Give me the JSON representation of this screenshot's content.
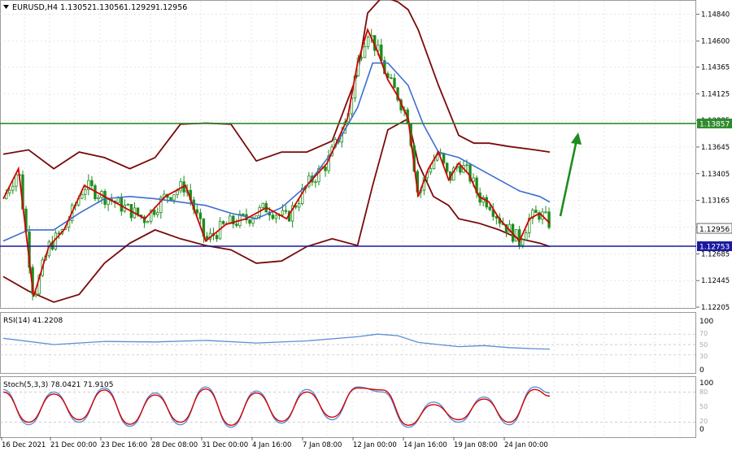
{
  "header": {
    "symbol_label": "EURUSD,H4",
    "ohlc": [
      "1.13052",
      "1.13056",
      "1.12929",
      "1.12956"
    ]
  },
  "colors": {
    "price_line": "#d40000",
    "ma_line": "#3b6fd1",
    "bands": "#7a0a0a",
    "candles": "#1e8c1e",
    "support": "#1a1aa0",
    "resistance": "#2e8b2e",
    "arrow": "#1e8c1e",
    "rsi_line": "#5b8fd6",
    "stoch_main": "#5b8fd6",
    "stoch_signal": "#d40000",
    "grid": "#d7d7d7"
  },
  "price_axis": {
    "ticks": [
      "1.14840",
      "1.14600",
      "1.14365",
      "1.14125",
      "1.13885",
      "1.13645",
      "1.13405",
      "1.13165",
      "1.12925",
      "1.12685",
      "1.12445",
      "1.12205"
    ],
    "current_price": "1.12956",
    "resistance_label": "1.13857",
    "support_label": "1.12753"
  },
  "time_axis": {
    "labels": [
      "16 Dec 2021",
      "21 Dec 00:00",
      "23 Dec 16:00",
      "28 Dec 08:00",
      "31 Dec 00:00",
      "4 Jan 16:00",
      "7 Jan 08:00",
      "12 Jan 00:00",
      "14 Jan 16:00",
      "19 Jan 08:00",
      "24 Jan 00:00"
    ]
  },
  "rsi": {
    "label": "RSI(14) 41.2208",
    "axis_labels": [
      "100",
      "70",
      "50",
      "30",
      "0"
    ]
  },
  "stoch": {
    "label": "Stoch(5,3,3) 78.0421 71.9105",
    "axis_labels": [
      "100",
      "80",
      "50",
      "20",
      "0"
    ]
  },
  "chart_data": {
    "type": "line",
    "title": "EURUSD,H4",
    "ylim": [
      1.12205,
      1.1496
    ],
    "categories": [
      "16 Dec 2021",
      "21 Dec 00:00",
      "23 Dec 16:00",
      "28 Dec 08:00",
      "31 Dec 00:00",
      "4 Jan 16:00",
      "7 Jan 08:00",
      "12 Jan 00:00",
      "14 Jan 16:00",
      "19 Jan 08:00",
      "24 Jan 00:00"
    ],
    "levels": [
      {
        "name": "resistance",
        "value": 1.13857
      },
      {
        "name": "support",
        "value": 1.12753
      }
    ],
    "series": [
      {
        "name": "price",
        "x": [
          0,
          0.3,
          0.6,
          0.9,
          1.2,
          1.6,
          2.0,
          2.4,
          2.8,
          3.2,
          3.6,
          4.0,
          4.4,
          4.8,
          5.2,
          5.6,
          6.0,
          6.4,
          6.8,
          7.0,
          7.2,
          7.4,
          7.6,
          7.8,
          8.0,
          8.2,
          8.4,
          8.6,
          8.8,
          9.0,
          9.2,
          9.4,
          9.6,
          9.8,
          10.0,
          10.2,
          10.4,
          10.6,
          10.8
        ],
        "values": [
          1.1318,
          1.1345,
          1.123,
          1.1275,
          1.129,
          1.133,
          1.132,
          1.131,
          1.13,
          1.132,
          1.133,
          1.128,
          1.1295,
          1.13,
          1.131,
          1.13,
          1.133,
          1.135,
          1.139,
          1.144,
          1.147,
          1.145,
          1.1425,
          1.141,
          1.139,
          1.132,
          1.1345,
          1.136,
          1.1335,
          1.135,
          1.134,
          1.132,
          1.1315,
          1.13,
          1.129,
          1.128,
          1.13,
          1.1305,
          1.1296
        ]
      },
      {
        "name": "moving average",
        "x": [
          0,
          0.5,
          1.0,
          1.5,
          2.0,
          2.5,
          3.0,
          3.5,
          4.0,
          4.5,
          5.0,
          5.5,
          6.0,
          6.5,
          7.0,
          7.3,
          7.6,
          8.0,
          8.3,
          8.6,
          9.0,
          9.4,
          9.8,
          10.2,
          10.6,
          10.8
        ],
        "values": [
          1.128,
          1.129,
          1.129,
          1.1305,
          1.1318,
          1.132,
          1.1318,
          1.1315,
          1.1312,
          1.1305,
          1.13,
          1.131,
          1.133,
          1.136,
          1.14,
          1.144,
          1.144,
          1.142,
          1.1385,
          1.136,
          1.1355,
          1.1345,
          1.1335,
          1.1325,
          1.132,
          1.1315
        ]
      },
      {
        "name": "upper band",
        "x": [
          0,
          0.5,
          1.0,
          1.5,
          2.0,
          2.5,
          3.0,
          3.5,
          4.0,
          4.5,
          5.0,
          5.5,
          6.0,
          6.5,
          7.0,
          7.2,
          7.5,
          7.8,
          8.0,
          8.2,
          8.6,
          9.0,
          9.3,
          9.6,
          10.0,
          10.5,
          10.8
        ],
        "values": [
          1.1358,
          1.1362,
          1.1345,
          1.136,
          1.1355,
          1.1345,
          1.1355,
          1.1385,
          1.1386,
          1.1385,
          1.1352,
          1.136,
          1.136,
          1.137,
          1.143,
          1.1485,
          1.15,
          1.1495,
          1.1488,
          1.147,
          1.142,
          1.1375,
          1.1368,
          1.1368,
          1.1365,
          1.1362,
          1.136
        ]
      },
      {
        "name": "lower band",
        "x": [
          0,
          0.5,
          1.0,
          1.5,
          2.0,
          2.5,
          3.0,
          3.5,
          4.0,
          4.5,
          5.0,
          5.5,
          6.0,
          6.5,
          7.0,
          7.3,
          7.6,
          8.0,
          8.2,
          8.5,
          8.8,
          9.0,
          9.4,
          9.8,
          10.2,
          10.6,
          10.8
        ],
        "values": [
          1.1248,
          1.1235,
          1.1225,
          1.1232,
          1.126,
          1.1278,
          1.129,
          1.1282,
          1.1276,
          1.1272,
          1.126,
          1.1262,
          1.1275,
          1.1282,
          1.1276,
          1.133,
          1.138,
          1.139,
          1.135,
          1.132,
          1.1312,
          1.13,
          1.1296,
          1.129,
          1.1282,
          1.1278,
          1.1275
        ]
      },
      {
        "name": "RSI(14)",
        "x": [
          0,
          1,
          2,
          3,
          4,
          5,
          6,
          7,
          7.4,
          7.8,
          8.2,
          8.6,
          9.0,
          9.5,
          10.0,
          10.5,
          10.8
        ],
        "values": [
          62,
          50,
          56,
          55,
          58,
          53,
          57,
          65,
          70,
          67,
          54,
          50,
          46,
          48,
          44,
          42,
          41.2208
        ]
      },
      {
        "name": "Stoch(5,3,3) %K",
        "x": [
          0,
          0.5,
          1,
          1.5,
          2,
          2.5,
          3,
          3.5,
          4,
          4.5,
          5,
          5.5,
          6,
          6.5,
          7,
          7.5,
          8,
          8.5,
          9,
          9.5,
          10,
          10.5,
          10.8
        ],
        "values": [
          85,
          15,
          80,
          20,
          88,
          12,
          78,
          15,
          90,
          10,
          82,
          18,
          85,
          25,
          90,
          80,
          10,
          60,
          20,
          70,
          15,
          90,
          78.0421
        ]
      },
      {
        "name": "Stoch(5,3,3) %D",
        "x": [
          0,
          0.5,
          1,
          1.5,
          2,
          2.5,
          3,
          3.5,
          4,
          4.5,
          5,
          5.5,
          6,
          6.5,
          7,
          7.5,
          8,
          8.5,
          9,
          9.5,
          10,
          10.5,
          10.8
        ],
        "values": [
          80,
          20,
          76,
          25,
          84,
          16,
          74,
          20,
          86,
          14,
          78,
          22,
          80,
          30,
          88,
          84,
          14,
          55,
          25,
          66,
          20,
          85,
          71.9105
        ]
      }
    ]
  }
}
